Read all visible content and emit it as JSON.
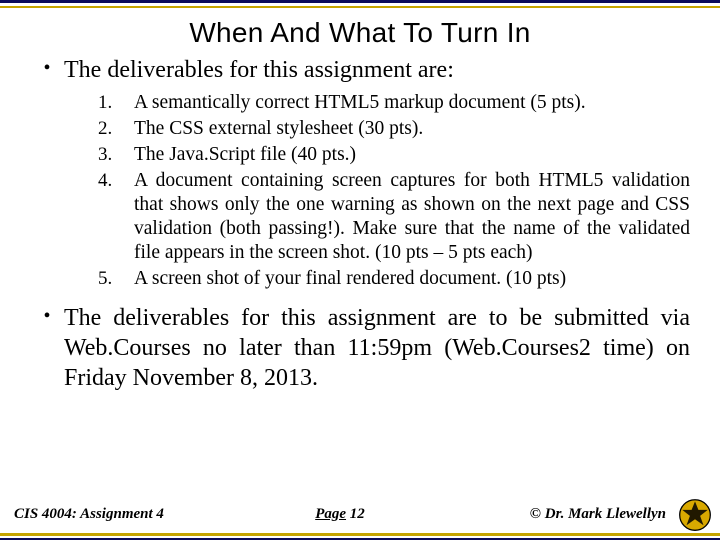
{
  "title": "When And What To Turn In",
  "bullets": [
    {
      "text": "The deliverables for this assignment are:",
      "justify": false
    },
    {
      "text": "The deliverables for this assignment are to be submitted via Web.Courses no later than 11:59pm (Web.Courses2 time) on Friday November 8, 2013.",
      "justify": true
    }
  ],
  "ordered": [
    {
      "n": "1.",
      "text": "A semantically correct HTML5 markup document (5 pts)."
    },
    {
      "n": "2.",
      "text": "The CSS external stylesheet (30 pts)."
    },
    {
      "n": "3.",
      "text": "The Java.Script file (40 pts.)"
    },
    {
      "n": "4.",
      "text": "A document containing screen captures for both HTML5 validation that shows only the one warning as shown on the next page and CSS validation (both passing!).  Make sure that the name of the validated file appears in the screen shot. (10 pts – 5 pts each)"
    },
    {
      "n": "5.",
      "text": "A screen shot of your final rendered document. (10 pts)"
    }
  ],
  "footer": {
    "left": "CIS 4004:  Assignment 4",
    "page_label": "Page",
    "page_num": "12",
    "right": "© Dr. Mark Llewellyn"
  }
}
